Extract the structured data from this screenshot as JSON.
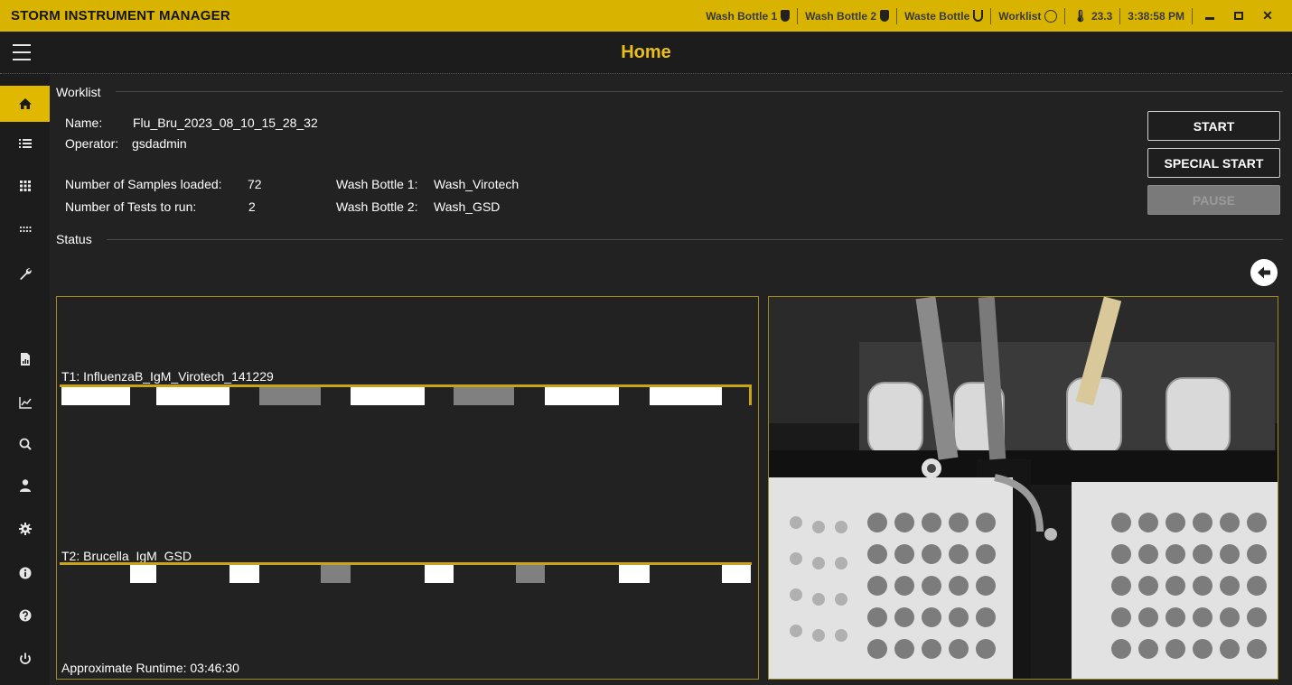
{
  "app": {
    "title": "STORM INSTRUMENT MANAGER"
  },
  "statusbar": {
    "wash_bottle_1": "Wash Bottle 1",
    "wash_bottle_2": "Wash Bottle 2",
    "waste_bottle": "Waste Bottle",
    "worklist": "Worklist",
    "temperature": "23.3",
    "time": "3:38:58 PM"
  },
  "header": {
    "title": "Home"
  },
  "sidebar": {
    "items": [
      {
        "icon": "home-icon",
        "active": true
      },
      {
        "icon": "list-icon",
        "active": false
      },
      {
        "icon": "plate-grid-icon",
        "active": false
      },
      {
        "icon": "strip-dots-icon",
        "active": false
      },
      {
        "icon": "wrench-icon",
        "active": false
      },
      {
        "icon": "report-icon",
        "active": false
      },
      {
        "icon": "chart-icon",
        "active": false
      },
      {
        "icon": "search-icon",
        "active": false
      },
      {
        "icon": "user-icon",
        "active": false
      },
      {
        "icon": "gear-icon",
        "active": false
      },
      {
        "icon": "info-icon",
        "active": false
      },
      {
        "icon": "help-icon",
        "active": false
      },
      {
        "icon": "power-icon",
        "active": false
      }
    ]
  },
  "worklist": {
    "section_label": "Worklist",
    "name_label": "Name:",
    "name_value": "Flu_Bru_2023_08_10_15_28_32",
    "operator_label": "Operator:",
    "operator_value": "gsdadmin",
    "samples_label": "Number of Samples loaded:",
    "samples_value": "72",
    "tests_label": "Number of Tests to run:",
    "tests_value": "2",
    "wash1_label": "Wash Bottle 1:",
    "wash1_value": "Wash_Virotech",
    "wash2_label": "Wash Bottle 2:",
    "wash2_value": "Wash_GSD"
  },
  "buttons": {
    "start": "START",
    "special_start": "SPECIAL START",
    "pause": "PAUSE"
  },
  "status": {
    "section_label": "Status",
    "runtime": "Approximate Runtime: 03:46:30",
    "tests": [
      {
        "label": "T1: InfluenzaB_IgM_Virotech_141229"
      },
      {
        "label": "T2: Brucella_IgM_GSD"
      }
    ]
  },
  "colors": {
    "accent": "#e0b800",
    "title_gold": "#e8bf1c",
    "background": "#222222",
    "block_done": "#ffffff",
    "block_pending": "#808080"
  }
}
